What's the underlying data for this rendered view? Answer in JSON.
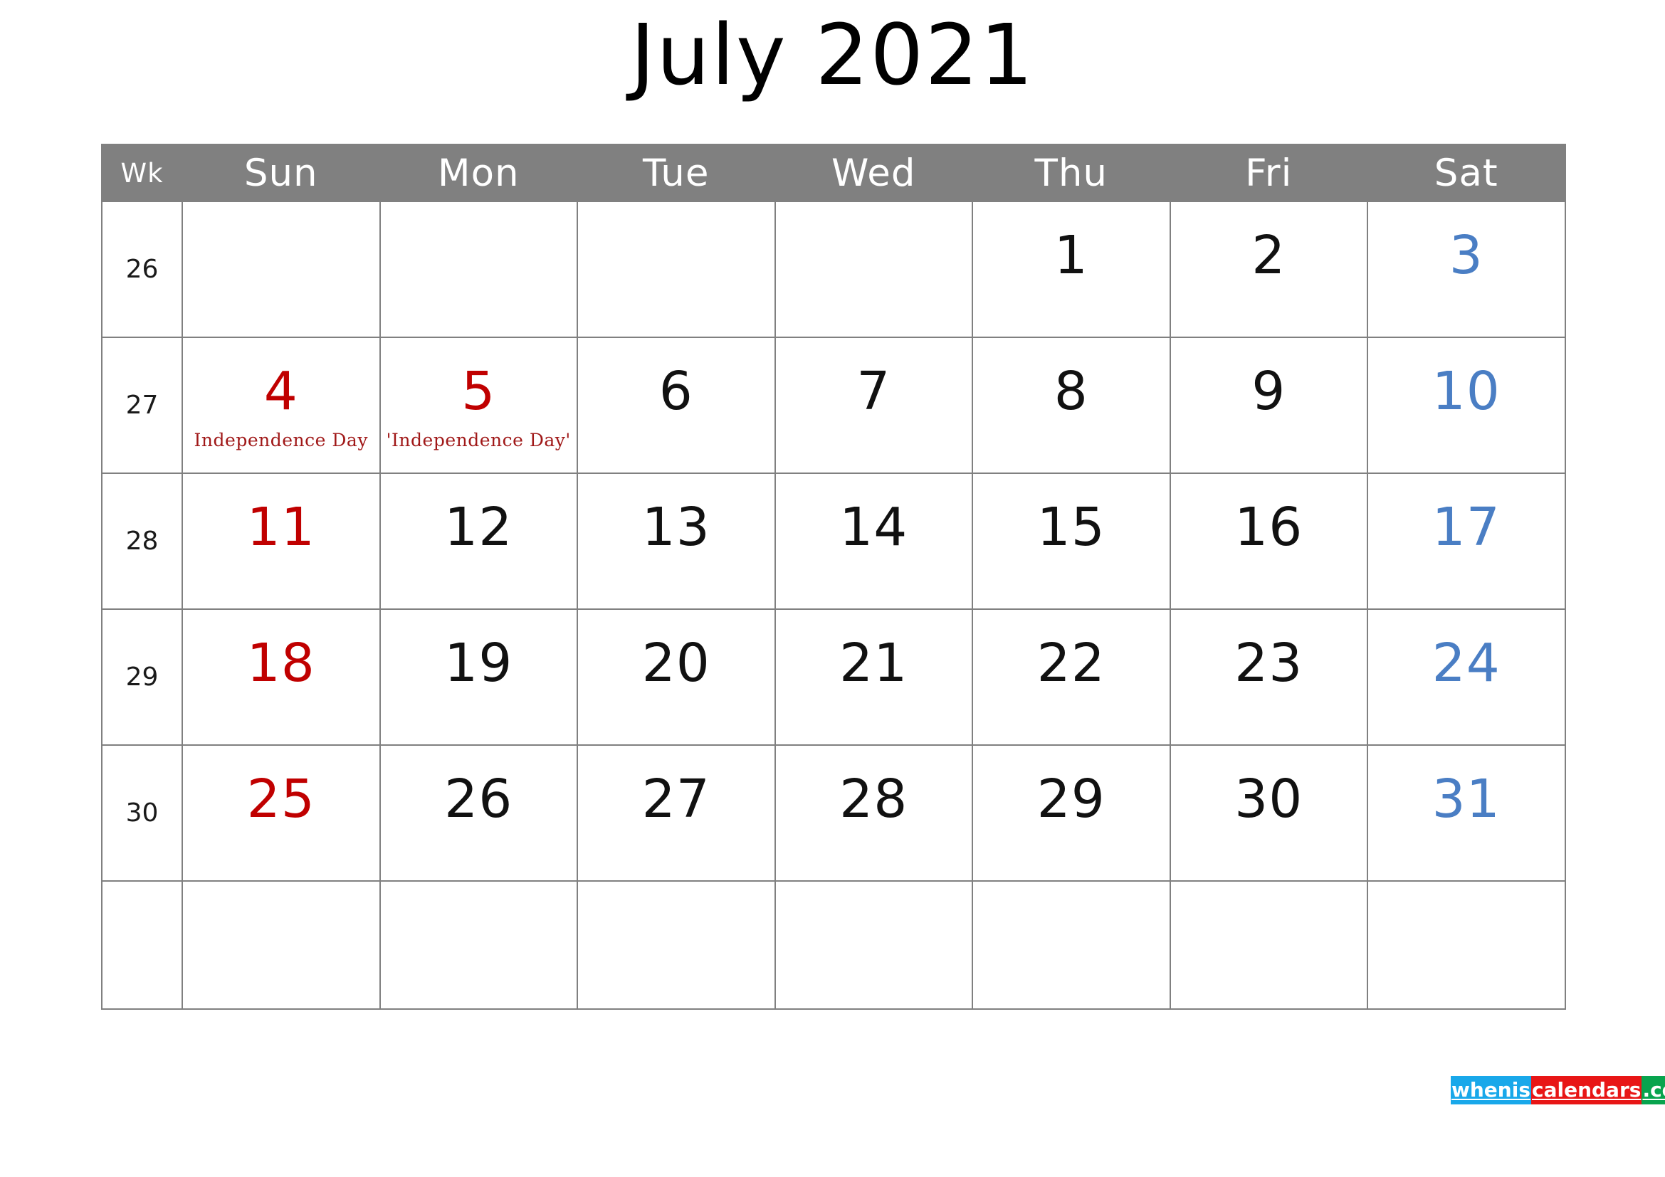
{
  "title": "July 2021",
  "colors": {
    "header_background": "#808080",
    "grid_line": "#808080",
    "sunday": "#c00000",
    "saturday": "#4a7ec4",
    "weekday": "#111111",
    "event_text": "#a01818",
    "watermark_blue": "#19a8ea",
    "watermark_red": "#e81616",
    "watermark_green": "#08a44e"
  },
  "header": {
    "week_label": "Wk",
    "days": [
      "Sun",
      "Mon",
      "Tue",
      "Wed",
      "Thu",
      "Fri",
      "Sat"
    ]
  },
  "weeks": [
    {
      "week_number": "26",
      "days": [
        {
          "date": "",
          "event": ""
        },
        {
          "date": "",
          "event": ""
        },
        {
          "date": "",
          "event": ""
        },
        {
          "date": "",
          "event": ""
        },
        {
          "date": "1",
          "event": ""
        },
        {
          "date": "2",
          "event": ""
        },
        {
          "date": "3",
          "event": ""
        }
      ]
    },
    {
      "week_number": "27",
      "days": [
        {
          "date": "4",
          "event": "Independence Day"
        },
        {
          "date": "5",
          "event": "'Independence Day'"
        },
        {
          "date": "6",
          "event": ""
        },
        {
          "date": "7",
          "event": ""
        },
        {
          "date": "8",
          "event": ""
        },
        {
          "date": "9",
          "event": ""
        },
        {
          "date": "10",
          "event": ""
        }
      ]
    },
    {
      "week_number": "28",
      "days": [
        {
          "date": "11",
          "event": ""
        },
        {
          "date": "12",
          "event": ""
        },
        {
          "date": "13",
          "event": ""
        },
        {
          "date": "14",
          "event": ""
        },
        {
          "date": "15",
          "event": ""
        },
        {
          "date": "16",
          "event": ""
        },
        {
          "date": "17",
          "event": ""
        }
      ]
    },
    {
      "week_number": "29",
      "days": [
        {
          "date": "18",
          "event": ""
        },
        {
          "date": "19",
          "event": ""
        },
        {
          "date": "20",
          "event": ""
        },
        {
          "date": "21",
          "event": ""
        },
        {
          "date": "22",
          "event": ""
        },
        {
          "date": "23",
          "event": ""
        },
        {
          "date": "24",
          "event": ""
        }
      ]
    },
    {
      "week_number": "30",
      "days": [
        {
          "date": "25",
          "event": ""
        },
        {
          "date": "26",
          "event": ""
        },
        {
          "date": "27",
          "event": ""
        },
        {
          "date": "28",
          "event": ""
        },
        {
          "date": "29",
          "event": ""
        },
        {
          "date": "30",
          "event": ""
        },
        {
          "date": "31",
          "event": ""
        }
      ]
    },
    {
      "week_number": "",
      "days": [
        {
          "date": "",
          "event": ""
        },
        {
          "date": "",
          "event": ""
        },
        {
          "date": "",
          "event": ""
        },
        {
          "date": "",
          "event": ""
        },
        {
          "date": "",
          "event": ""
        },
        {
          "date": "",
          "event": ""
        },
        {
          "date": "",
          "event": ""
        }
      ]
    }
  ],
  "watermark": {
    "part1": "whenis",
    "part2": "calendars",
    "part3": ".com"
  }
}
